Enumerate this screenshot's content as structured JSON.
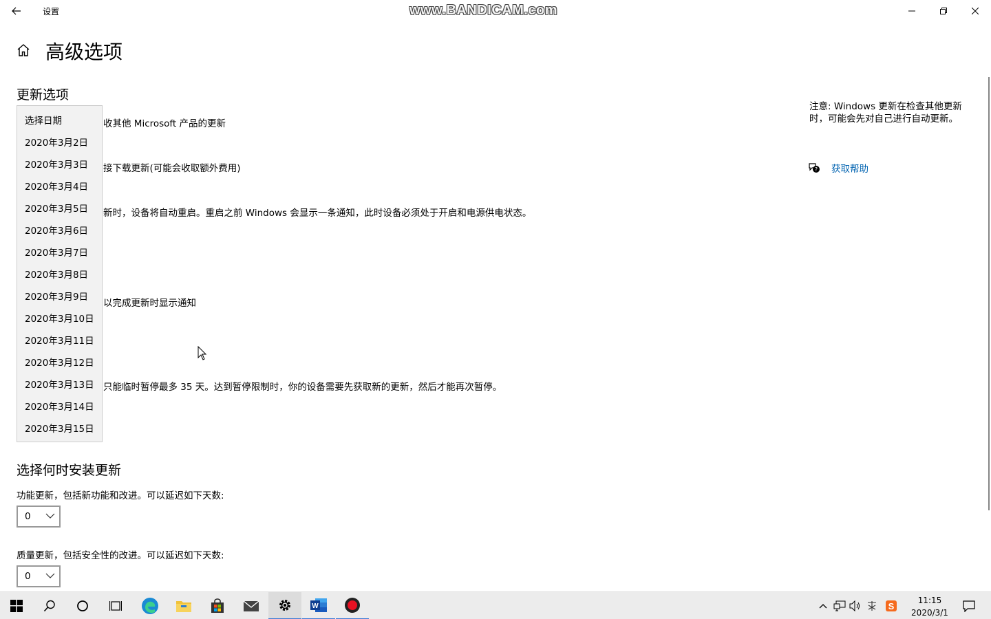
{
  "window": {
    "title": "设置",
    "watermark": "www.BANDICAM.com"
  },
  "page": {
    "title": "高级选项"
  },
  "update_options": {
    "heading": "更新选项",
    "line1": "收其他 Microsoft 产品的更新",
    "line2": "接下载更新(可能会收取额外费用)",
    "line3": "新时，设备将自动重启。重启之前 Windows 会显示一条通知，此时设备必须处于开启和电源供电状态。",
    "line4": "以完成更新时显示通知",
    "line5": "只能临时暂停最多 35 天。达到暂停限制时，你的设备需要先获取新的更新，然后才能再次暂停。"
  },
  "date_dropdown": {
    "items": [
      "选择日期",
      "2020年3月2日",
      "2020年3月3日",
      "2020年3月4日",
      "2020年3月5日",
      "2020年3月6日",
      "2020年3月7日",
      "2020年3月8日",
      "2020年3月9日",
      "2020年3月10日",
      "2020年3月11日",
      "2020年3月12日",
      "2020年3月13日",
      "2020年3月14日",
      "2020年3月15日"
    ]
  },
  "install_timing": {
    "heading": "选择何时安装更新",
    "feature_label": "功能更新，包括新功能和改进。可以延迟如下天数:",
    "feature_value": "0",
    "quality_label": "质量更新，包括安全性的改进。可以延迟如下天数:",
    "quality_value": "0"
  },
  "side_panel": {
    "note": "注意: Windows 更新在检查其他更新时，可能会先对自己进行自动更新。",
    "help_label": "获取帮助"
  },
  "taskbar": {
    "time": "11:15",
    "date": "2020/3/1",
    "accent": "#3a78d6"
  }
}
